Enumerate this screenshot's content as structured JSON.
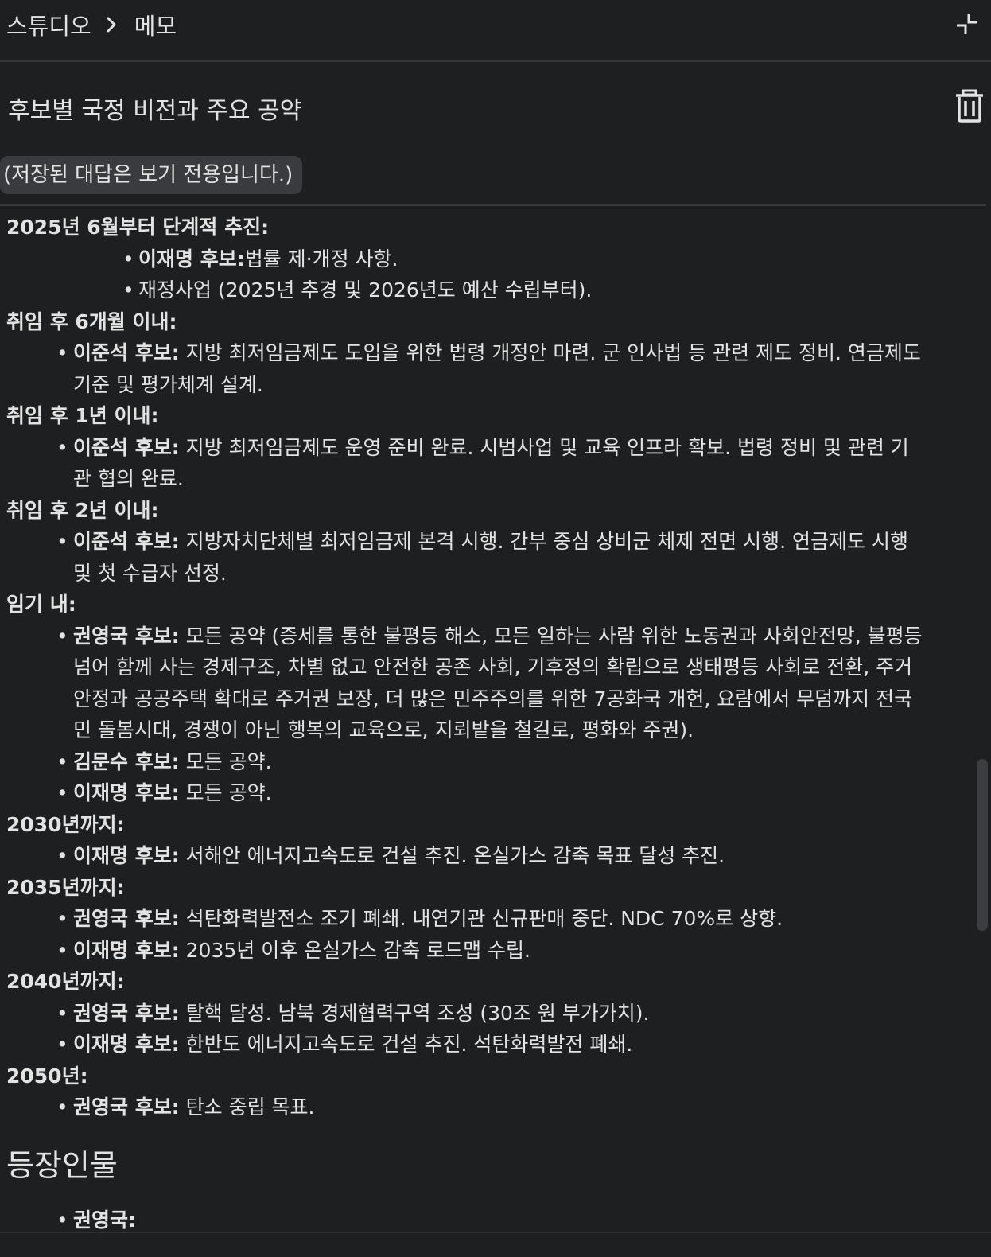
{
  "header": {
    "breadcrumb_root": "스튜디오",
    "breadcrumb_current": "메모"
  },
  "note": {
    "title": "후보별 국정 비전과 주요 공약",
    "readonly_notice": "(저장된 대답은 보기 전용입니다.)"
  },
  "sections": [
    {
      "heading": "2025년 6월부터 단계적 추진:",
      "items": [
        {
          "label": "이재명 후보:",
          "text": "법률 제·개정 사항."
        },
        {
          "label": "",
          "text": "재정사업 (2025년 추경 및 2026년도 예산 수립부터)."
        }
      ]
    },
    {
      "heading": "취임 후 6개월 이내:",
      "items": [
        {
          "label": "이준석 후보:",
          "text": "지방 최저임금제도 도입을 위한 법령 개정안 마련. 군 인사법 등 관련 제도 정비. 연금제도",
          "text2": "기준 및 평가체계 설계."
        }
      ]
    },
    {
      "heading": "취임 후 1년 이내:",
      "items": [
        {
          "label": "이준석 후보:",
          "text": "지방 최저임금제도 운영 준비 완료. 시범사업 및 교육 인프라 확보. 법령 정비 및 관련 기",
          "text2": "관 협의 완료."
        }
      ]
    },
    {
      "heading": "취임 후 2년 이내:",
      "items": [
        {
          "label": "이준석 후보:",
          "text": "지방자치단체별 최저임금제 본격 시행. 간부 중심 상비군 체제 전면 시행. 연금제도 시행",
          "text2": "및 첫 수급자 선정."
        }
      ]
    },
    {
      "heading": "임기 내:",
      "items": [
        {
          "label": "권영국 후보:",
          "text": "모든 공약 (증세를 통한 불평등 해소, 모든 일하는 사람 위한 노동권과 사회안전망, 불평등",
          "text2": "넘어 함께 사는 경제구조, 차별 없고 안전한 공존 사회, 기후정의 확립으로 생태평등 사회로 전환, 주거",
          "text3": "안정과 공공주택 확대로 주거권 보장, 더 많은 민주주의를 위한 7공화국 개헌, 요람에서 무덤까지 전국",
          "text4": "민 돌봄시대, 경쟁이 아닌 행복의 교육으로, 지뢰밭을 철길로, 평화와 주권)."
        },
        {
          "label": "김문수 후보:",
          "text": "모든 공약."
        },
        {
          "label": "이재명 후보:",
          "text": "모든 공약."
        }
      ]
    },
    {
      "heading": "2030년까지:",
      "items": [
        {
          "label": "이재명 후보:",
          "text": "서해안 에너지고속도로 건설 추진. 온실가스 감축 목표 달성 추진."
        }
      ]
    },
    {
      "heading": "2035년까지:",
      "items": [
        {
          "label": "권영국 후보:",
          "text": "석탄화력발전소 조기 폐쇄. 내연기관 신규판매 중단. NDC 70%로 상향."
        },
        {
          "label": "이재명 후보:",
          "text": "2035년 이후 온실가스 감축 로드맵 수립."
        }
      ]
    },
    {
      "heading": "2040년까지:",
      "items": [
        {
          "label": "권영국 후보:",
          "text": "탈핵 달성. 남북 경제협력구역 조성 (30조 원 부가가치)."
        },
        {
          "label": "이재명 후보:",
          "text": "한반도 에너지고속도로 건설 추진. 석탄화력발전 폐쇄."
        }
      ]
    },
    {
      "heading": "2050년:",
      "items": [
        {
          "label": "권영국 후보:",
          "text": "탄소 중립 목표."
        }
      ]
    }
  ],
  "characters": {
    "heading": "등장인물",
    "first_item": "권영국:"
  },
  "icons": {
    "breadcrumb_separator": "chevron-right-icon",
    "collapse": "collapse-icon",
    "delete": "trash-icon"
  },
  "colors": {
    "background": "#1e1f20",
    "text": "#e3e3e3",
    "notice_bg": "#3a3b3e"
  }
}
